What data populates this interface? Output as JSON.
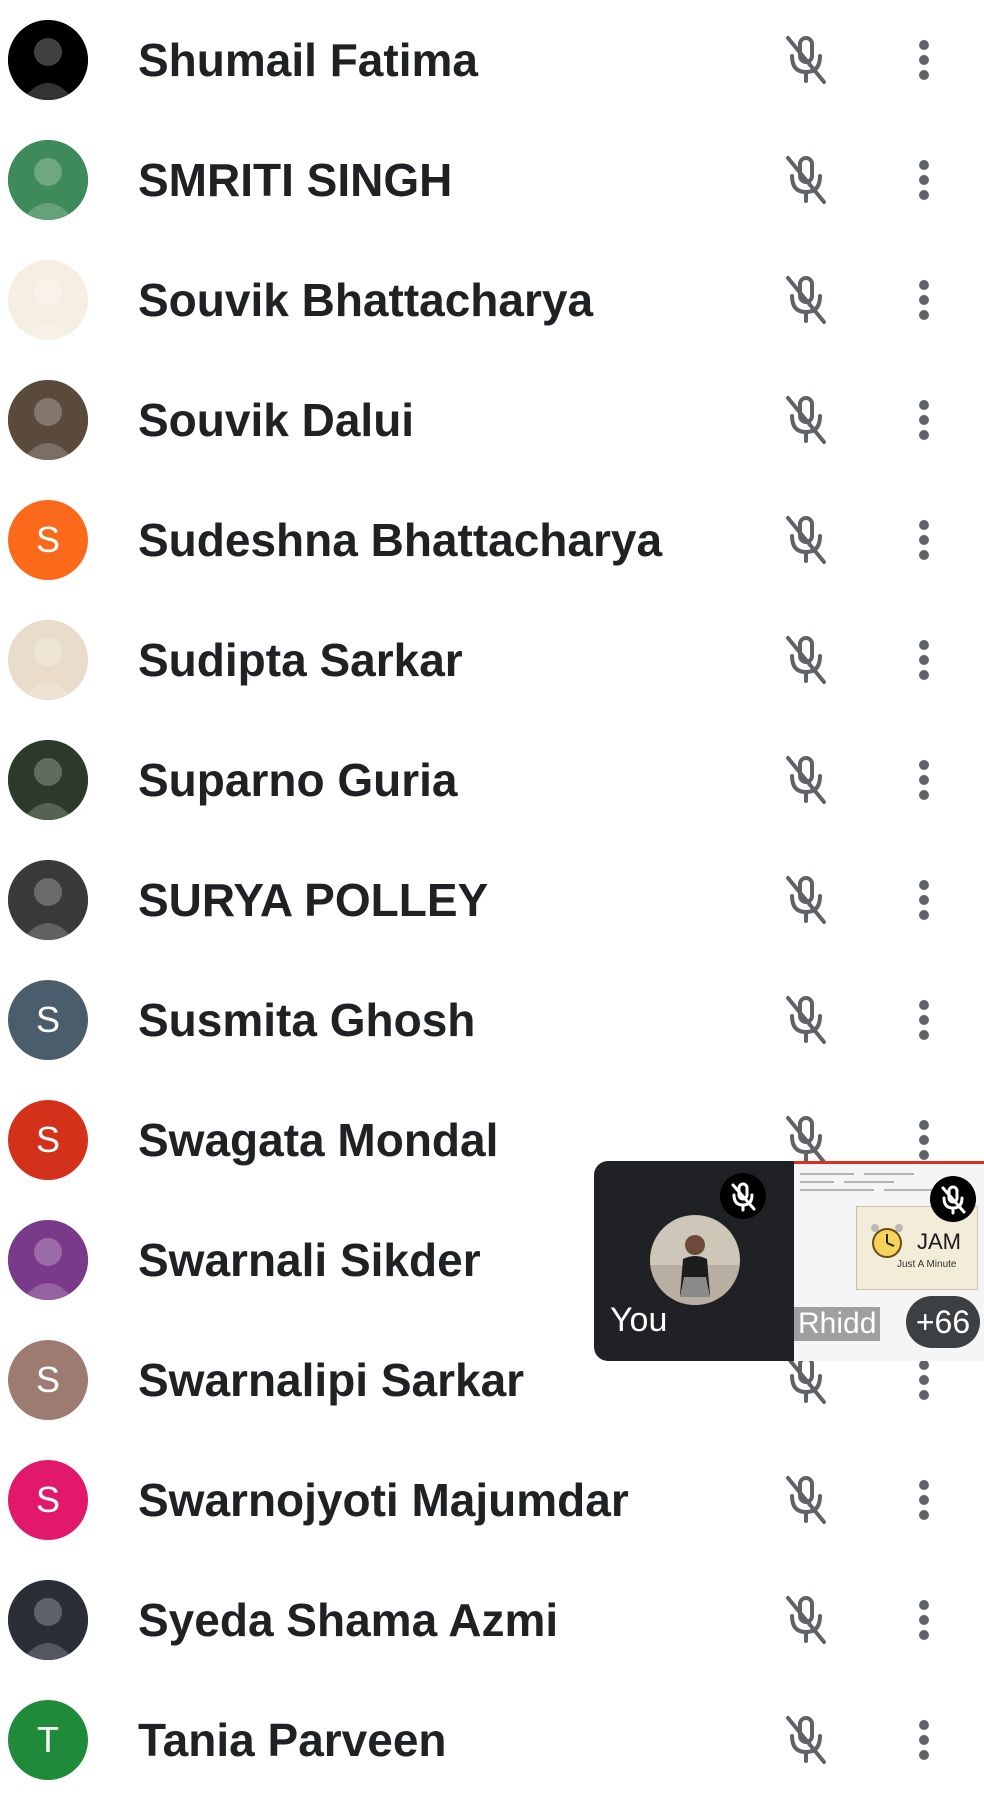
{
  "participants": [
    {
      "name": "Shumail Fatima",
      "avatar_type": "photo",
      "avatar_bg": "#000000",
      "avatar_letter": ""
    },
    {
      "name": "SMRITI SINGH",
      "avatar_type": "photo",
      "avatar_bg": "#3f8a5a",
      "avatar_letter": ""
    },
    {
      "name": "Souvik Bhattacharya",
      "avatar_type": "photo",
      "avatar_bg": "#f5efe2",
      "avatar_letter": ""
    },
    {
      "name": "Souvik Dalui",
      "avatar_type": "photo",
      "avatar_bg": "#5a4a3c",
      "avatar_letter": ""
    },
    {
      "name": "Sudeshna Bhattacharya",
      "avatar_type": "letter",
      "avatar_bg": "#fa6a1a",
      "avatar_letter": "S"
    },
    {
      "name": "Sudipta Sarkar",
      "avatar_type": "photo",
      "avatar_bg": "#e9dccb",
      "avatar_letter": ""
    },
    {
      "name": "Suparno Guria",
      "avatar_type": "photo",
      "avatar_bg": "#2d3a2a",
      "avatar_letter": ""
    },
    {
      "name": "SURYA POLLEY",
      "avatar_type": "photo",
      "avatar_bg": "#3a3a3a",
      "avatar_letter": ""
    },
    {
      "name": "Susmita Ghosh",
      "avatar_type": "letter",
      "avatar_bg": "#4a5d6c",
      "avatar_letter": "S"
    },
    {
      "name": "Swagata Mondal",
      "avatar_type": "letter",
      "avatar_bg": "#d4311a",
      "avatar_letter": "S"
    },
    {
      "name": "Swarnali Sikder",
      "avatar_type": "photo",
      "avatar_bg": "#7a3a8a",
      "avatar_letter": ""
    },
    {
      "name": "Swarnalipi Sarkar",
      "avatar_type": "letter",
      "avatar_bg": "#9e7b70",
      "avatar_letter": "S"
    },
    {
      "name": "Swarnojyoti Majumdar",
      "avatar_type": "letter",
      "avatar_bg": "#e2196b",
      "avatar_letter": "S"
    },
    {
      "name": "Syeda Shama Azmi",
      "avatar_type": "photo",
      "avatar_bg": "#2a2f36",
      "avatar_letter": ""
    },
    {
      "name": "Tania Parveen",
      "avatar_type": "letter",
      "avatar_bg": "#1e8a3a",
      "avatar_letter": "T"
    }
  ],
  "row_icons": {
    "mic": "mic-off-icon",
    "menu": "more-vert-icon"
  },
  "overlay": {
    "self_label": "You",
    "presenter_label": "Rhidd",
    "more_count": "+66",
    "slide_title": "JAM",
    "slide_subtitle": "Just A Minute",
    "mic_icon": "mic-off-icon"
  },
  "colors": {
    "icon_gray": "#5f6368",
    "text": "#202124",
    "overlay_bg": "#202124",
    "present_border": "#d93025"
  }
}
